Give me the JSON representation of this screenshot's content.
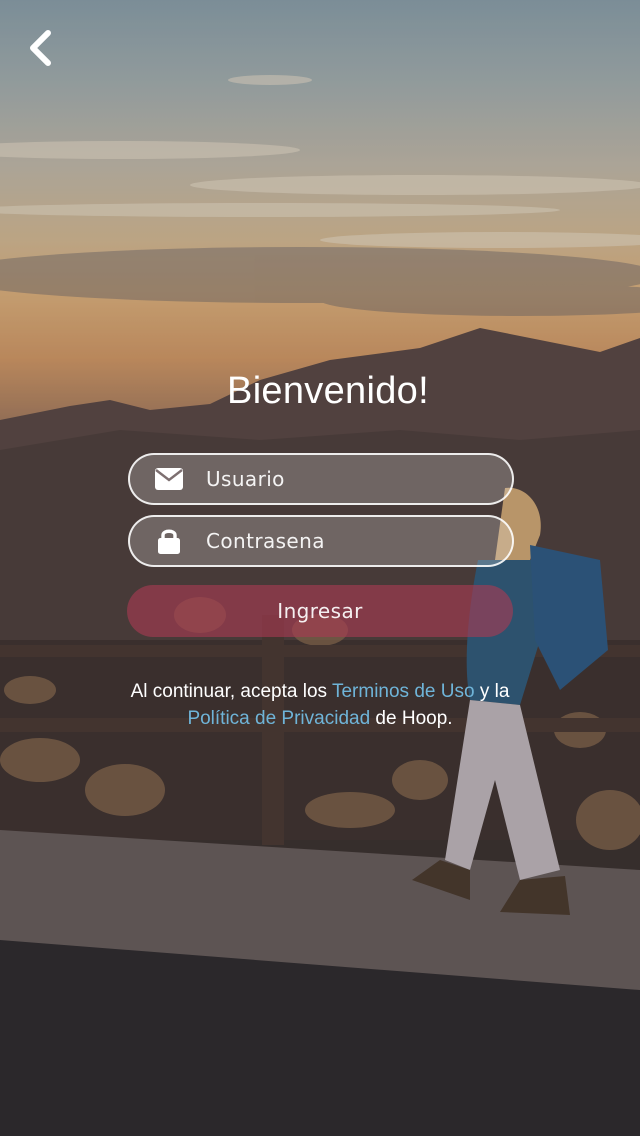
{
  "header": {
    "back_icon": "chevron-left-icon"
  },
  "login": {
    "title": "Bienvenido!",
    "username": {
      "icon": "envelope-icon",
      "placeholder": "Usuario",
      "value": ""
    },
    "password": {
      "icon": "lock-icon",
      "placeholder": "Contrasena",
      "value": ""
    },
    "submit_label": "Ingresar",
    "submit_color": "#a83a52"
  },
  "terms": {
    "prefix": "Al continuar, acepta los ",
    "terms_link": "Terminos de Uso",
    "middle": " y la ",
    "privacy_link": "Política de Privacidad",
    "suffix": " de Hoop.",
    "link_color": "#6fb4d8"
  }
}
